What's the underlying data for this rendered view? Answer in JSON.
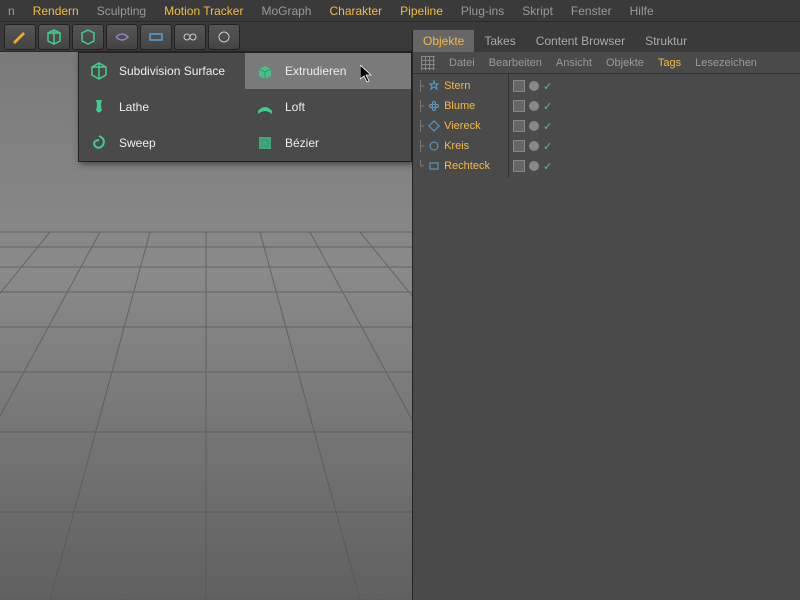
{
  "menubar": {
    "items": [
      {
        "label": "n",
        "highlight": false
      },
      {
        "label": "Rendern",
        "highlight": true
      },
      {
        "label": "Sculpting",
        "highlight": false
      },
      {
        "label": "Motion Tracker",
        "highlight": true
      },
      {
        "label": "MoGraph",
        "highlight": false
      },
      {
        "label": "Charakter",
        "highlight": true
      },
      {
        "label": "Pipeline",
        "highlight": true
      },
      {
        "label": "Plug-ins",
        "highlight": false
      },
      {
        "label": "Skript",
        "highlight": false
      },
      {
        "label": "Fenster",
        "highlight": false
      },
      {
        "label": "Hilfe",
        "highlight": false
      }
    ]
  },
  "dropdown": {
    "col1": [
      {
        "label": "Subdivision Surface",
        "icon": "cube"
      },
      {
        "label": "Lathe",
        "icon": "vase"
      },
      {
        "label": "Sweep",
        "icon": "swirl"
      }
    ],
    "col2": [
      {
        "label": "Extrudieren",
        "icon": "extrude",
        "hover": true
      },
      {
        "label": "Loft",
        "icon": "loft"
      },
      {
        "label": "Bézier",
        "icon": "bezier"
      }
    ]
  },
  "panel": {
    "tabs": [
      {
        "label": "Objekte",
        "active": true
      },
      {
        "label": "Takes",
        "active": false
      },
      {
        "label": "Content Browser",
        "active": false
      },
      {
        "label": "Struktur",
        "active": false
      }
    ],
    "menu": [
      {
        "label": "Datei",
        "highlight": false
      },
      {
        "label": "Bearbeiten",
        "highlight": false
      },
      {
        "label": "Ansicht",
        "highlight": false
      },
      {
        "label": "Objekte",
        "highlight": false
      },
      {
        "label": "Tags",
        "highlight": true
      },
      {
        "label": "Lesezeichen",
        "highlight": false
      }
    ],
    "objects": [
      {
        "name": "Stern",
        "shape": "star"
      },
      {
        "name": "Blume",
        "shape": "flower"
      },
      {
        "name": "Viereck",
        "shape": "diamond"
      },
      {
        "name": "Kreis",
        "shape": "circle"
      },
      {
        "name": "Rechteck",
        "shape": "rect"
      }
    ]
  }
}
